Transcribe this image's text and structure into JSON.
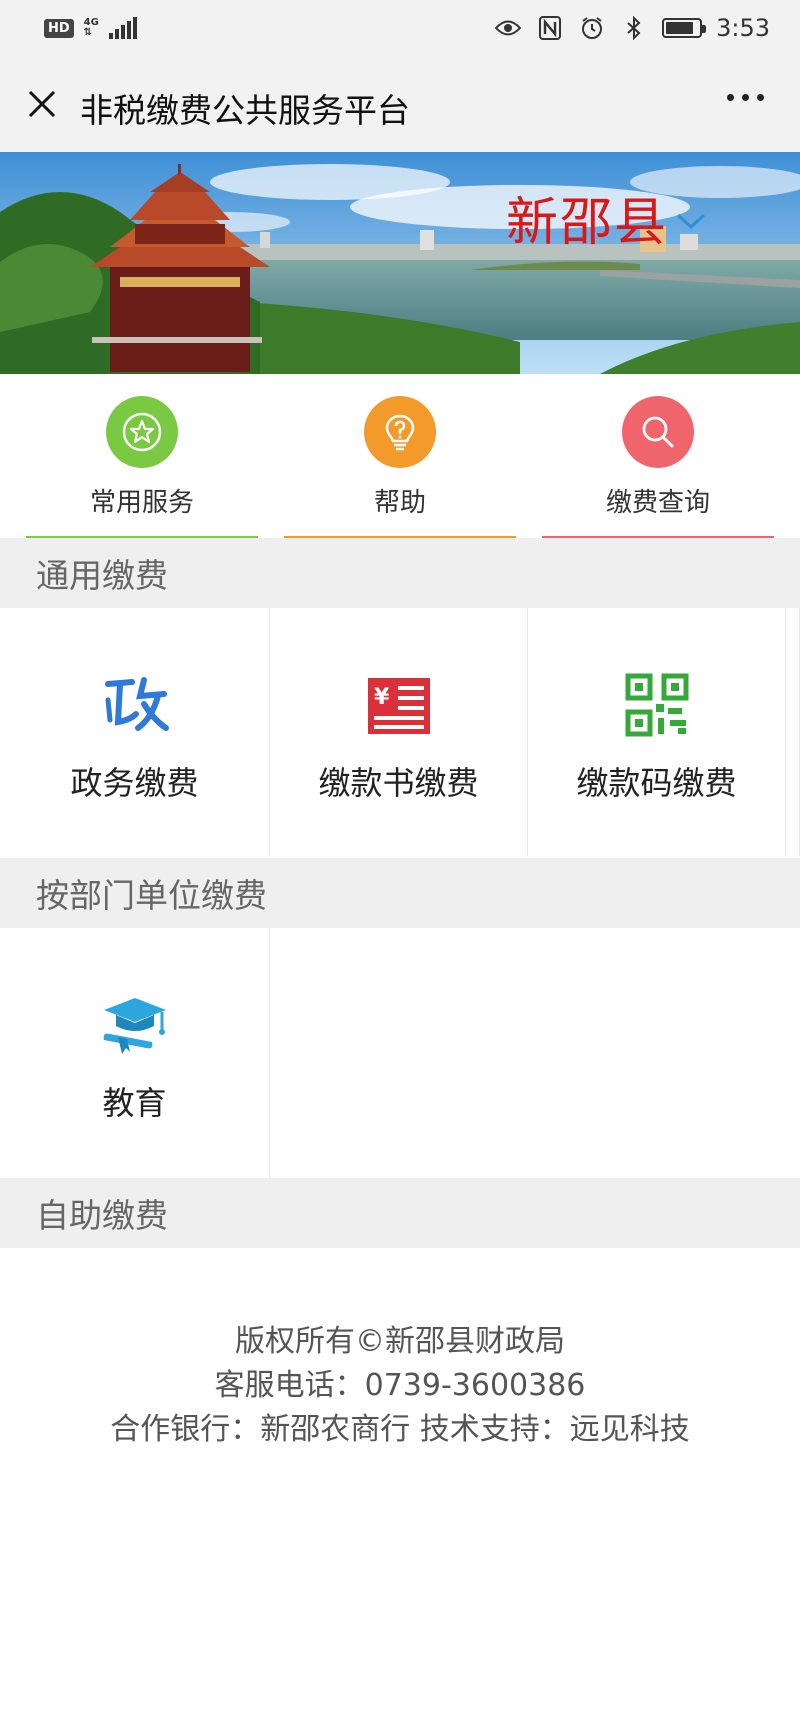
{
  "status_bar": {
    "hd": "HD",
    "network": "4G",
    "time": "3:53",
    "battery_level": 0.85
  },
  "nav": {
    "title": "非税缴费公共服务平台"
  },
  "banner": {
    "county": "新邵县"
  },
  "quick_actions": [
    {
      "label": "常用服务",
      "icon": "star-icon",
      "color": "#7ac943"
    },
    {
      "label": "帮助",
      "icon": "lightbulb-question-icon",
      "color": "#f39a2b"
    },
    {
      "label": "缴费查询",
      "icon": "search-icon",
      "color": "#f0656b"
    }
  ],
  "sections": {
    "general": {
      "title": "通用缴费",
      "items": [
        {
          "label": "政务缴费",
          "icon": "government-zheng-icon",
          "color": "#2f7ad8"
        },
        {
          "label": "缴款书缴费",
          "icon": "payment-voucher-icon",
          "color": "#d9303a"
        },
        {
          "label": "缴款码缴费",
          "icon": "qr-code-icon",
          "color": "#35a83a"
        }
      ]
    },
    "department": {
      "title": "按部门单位缴费",
      "items": [
        {
          "label": "教育",
          "icon": "graduation-cap-icon",
          "color": "#2da6dd"
        }
      ]
    },
    "self_service": {
      "title": "自助缴费"
    }
  },
  "footer": {
    "copyright": "版权所有©新邵县财政局",
    "hotline": "客服电话：0739-3600386",
    "partners": "合作银行：新邵农商行 技术支持：远见科技"
  }
}
